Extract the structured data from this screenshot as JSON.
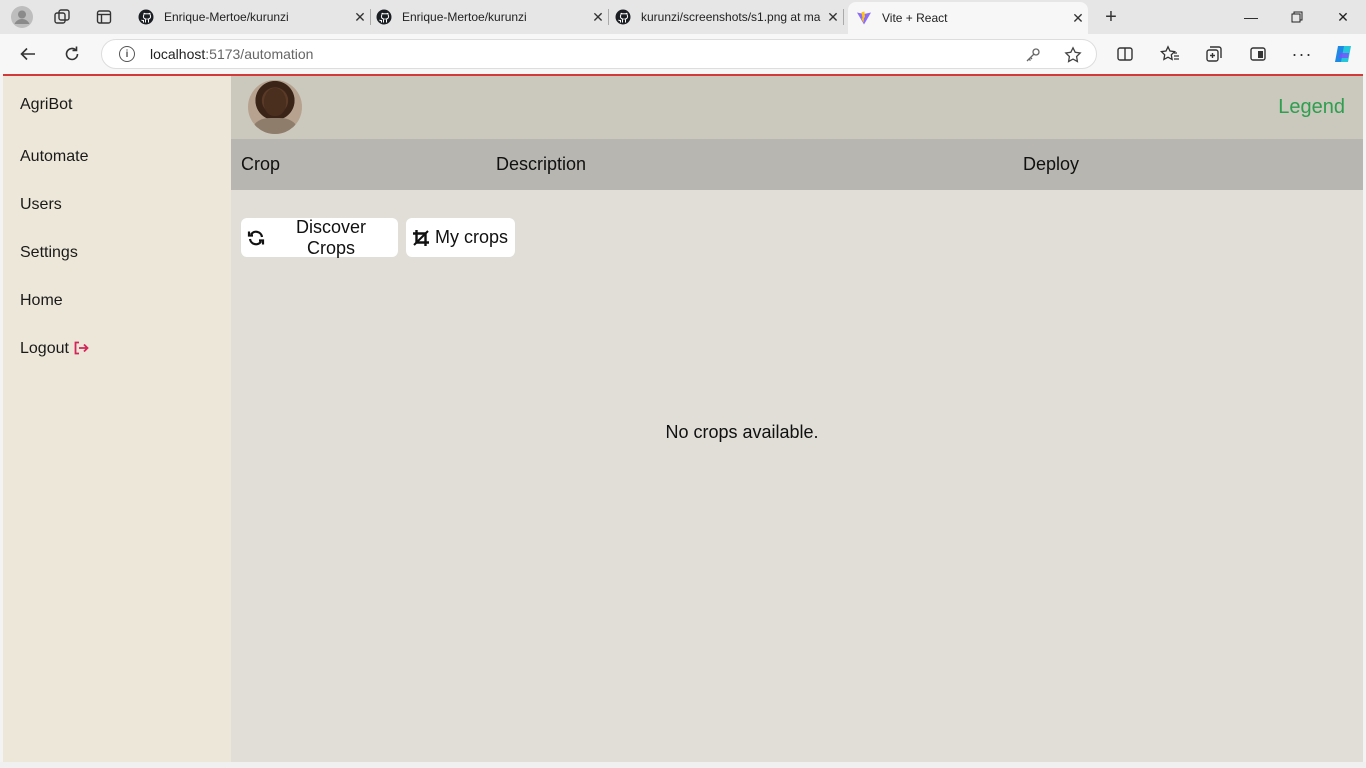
{
  "browser": {
    "tabs": [
      {
        "title": "Enrique-Mertoe/kurunzi",
        "icon": "github-icon"
      },
      {
        "title": "Enrique-Mertoe/kurunzi",
        "icon": "github-icon"
      },
      {
        "title": "kurunzi/screenshots/s1.png at ma",
        "icon": "github-icon"
      },
      {
        "title": "Vite + React",
        "icon": "vite-icon"
      }
    ],
    "address": {
      "host": "localhost",
      "path": ":5173/automation"
    }
  },
  "app": {
    "brand": "AgriBot",
    "nav": [
      "Automate",
      "Users",
      "Settings",
      "Home",
      "Logout"
    ],
    "legend_link": "Legend",
    "table_headers": [
      "Crop",
      "Description",
      "Deploy"
    ],
    "buttons": {
      "discover": "Discover Crops",
      "my_crops": "My crops"
    },
    "empty_message": "No crops available."
  },
  "colors": {
    "legend": "#2e9e4f",
    "logout_icon": "#d2265a",
    "accent_border": "#d23a3a"
  }
}
